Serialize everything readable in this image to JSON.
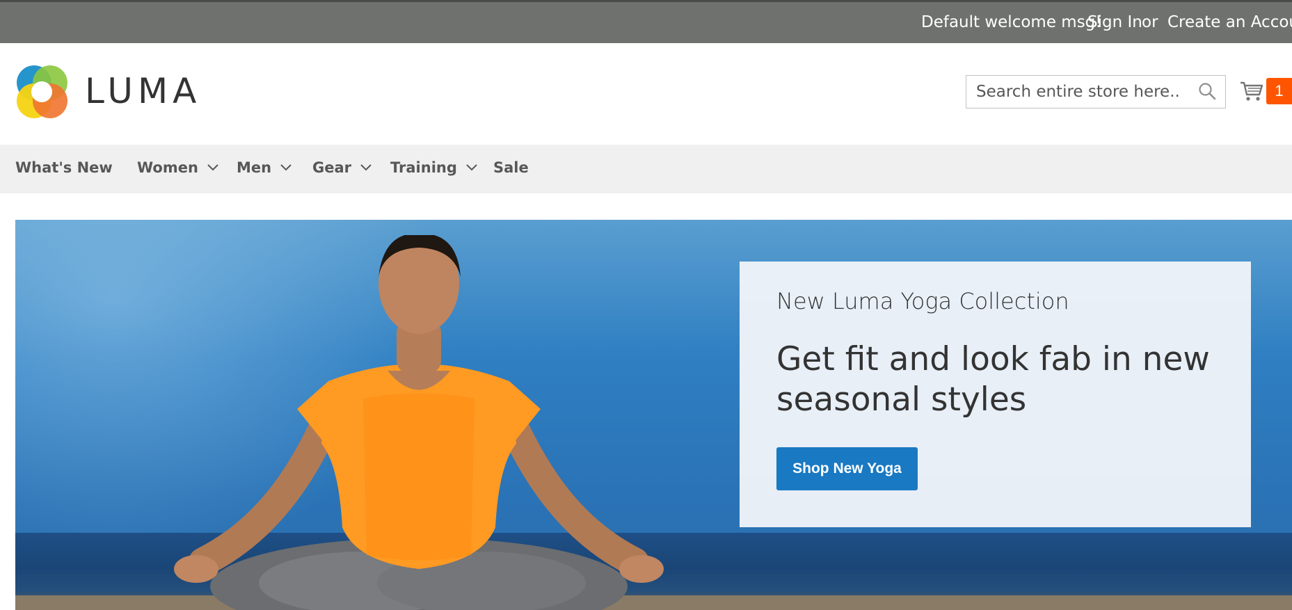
{
  "top_bar": {
    "welcome": "Default welcome msg!",
    "sign_in": "Sign In",
    "or": "or",
    "create_account": "Create an Account"
  },
  "header": {
    "logo_text": "LUMA",
    "search_placeholder": "Search entire store here...",
    "cart_count": "1"
  },
  "nav": {
    "items": [
      {
        "label": "What's New"
      },
      {
        "label": "Women"
      },
      {
        "label": "Men"
      },
      {
        "label": "Gear"
      },
      {
        "label": "Training"
      },
      {
        "label": "Sale"
      }
    ]
  },
  "hero": {
    "subtitle": "New Luma Yoga Collection",
    "headline": "Get fit and look fab in new seasonal styles",
    "button_label": "Shop New Yoga"
  },
  "colors": {
    "top_bar": "#6e716e",
    "cart_badge": "#ff5501",
    "cta": "#1979c3"
  },
  "icons": [
    "luma-logo-icon",
    "search-icon",
    "cart-icon",
    "chevron-down-icon"
  ]
}
